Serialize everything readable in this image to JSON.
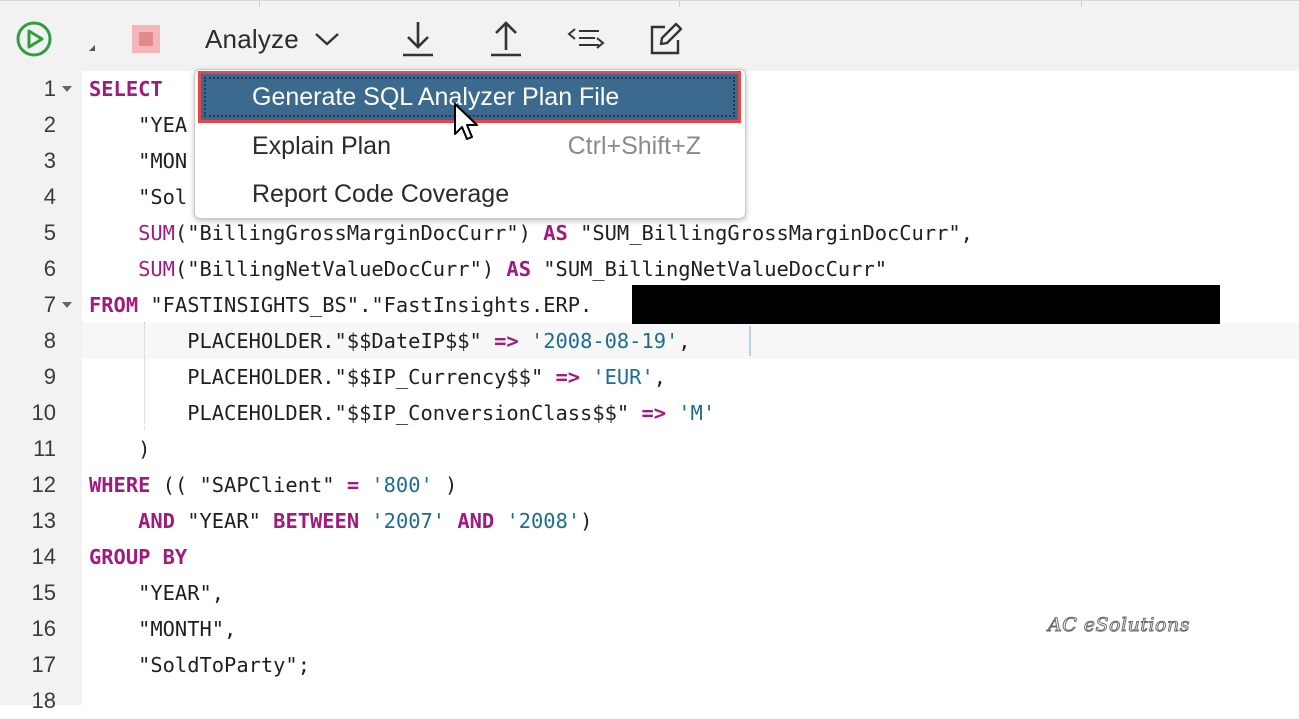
{
  "toolbar": {
    "analyze_label": "Analyze"
  },
  "menu": {
    "items": [
      {
        "label": "Generate SQL Analyzer Plan File",
        "shortcut": ""
      },
      {
        "label": "Explain Plan",
        "shortcut": "Ctrl+Shift+Z"
      },
      {
        "label": "Report Code Coverage",
        "shortcut": ""
      }
    ]
  },
  "editor": {
    "line_numbers": [
      "1",
      "2",
      "3",
      "4",
      "5",
      "6",
      "7",
      "8",
      "9",
      "10",
      "11",
      "12",
      "13",
      "14",
      "15",
      "16",
      "17",
      "18"
    ],
    "lines": [
      [
        {
          "t": "SELECT",
          "c": "kw"
        }
      ],
      [
        {
          "t": "    \"YEA",
          "c": ""
        }
      ],
      [
        {
          "t": "    \"MON",
          "c": ""
        }
      ],
      [
        {
          "t": "    \"Sol",
          "c": ""
        }
      ],
      [
        {
          "t": "    ",
          "c": ""
        },
        {
          "t": "SUM",
          "c": "fn"
        },
        {
          "t": "(\"BillingGrossMarginDocCurr\") ",
          "c": ""
        },
        {
          "t": "AS",
          "c": "kw"
        },
        {
          "t": " \"SUM_BillingGrossMarginDocCurr\",",
          "c": ""
        }
      ],
      [
        {
          "t": "    ",
          "c": ""
        },
        {
          "t": "SUM",
          "c": "fn"
        },
        {
          "t": "(\"BillingNetValueDocCurr\") ",
          "c": ""
        },
        {
          "t": "AS",
          "c": "kw"
        },
        {
          "t": " \"SUM_BillingNetValueDocCurr\"",
          "c": ""
        }
      ],
      [
        {
          "t": "FROM",
          "c": "kw"
        },
        {
          "t": " \"FASTINSIGHTS_BS\".\"FastInsights.ERP.",
          "c": ""
        }
      ],
      [
        {
          "t": "        PLACEHOLDER.\"$$DateIP$$\" ",
          "c": ""
        },
        {
          "t": "=>",
          "c": "op"
        },
        {
          "t": " ",
          "c": ""
        },
        {
          "t": "'2008-08-19'",
          "c": "str"
        },
        {
          "t": ",",
          "c": ""
        }
      ],
      [
        {
          "t": "        PLACEHOLDER.\"$$IP_Currency$$\" ",
          "c": ""
        },
        {
          "t": "=>",
          "c": "op"
        },
        {
          "t": " ",
          "c": ""
        },
        {
          "t": "'EUR'",
          "c": "str"
        },
        {
          "t": ",",
          "c": ""
        }
      ],
      [
        {
          "t": "        PLACEHOLDER.\"$$IP_ConversionClass$$\" ",
          "c": ""
        },
        {
          "t": "=>",
          "c": "op"
        },
        {
          "t": " ",
          "c": ""
        },
        {
          "t": "'M'",
          "c": "str"
        }
      ],
      [
        {
          "t": "    )",
          "c": ""
        }
      ],
      [
        {
          "t": "WHERE",
          "c": "kw"
        },
        {
          "t": " (( \"SAPClient\" ",
          "c": ""
        },
        {
          "t": "=",
          "c": "op"
        },
        {
          "t": " ",
          "c": ""
        },
        {
          "t": "'800'",
          "c": "str"
        },
        {
          "t": " )",
          "c": ""
        }
      ],
      [
        {
          "t": "    ",
          "c": ""
        },
        {
          "t": "AND",
          "c": "kw"
        },
        {
          "t": " \"YEAR\" ",
          "c": ""
        },
        {
          "t": "BETWEEN",
          "c": "kw"
        },
        {
          "t": " ",
          "c": ""
        },
        {
          "t": "'2007'",
          "c": "str"
        },
        {
          "t": " ",
          "c": ""
        },
        {
          "t": "AND",
          "c": "kw"
        },
        {
          "t": " ",
          "c": ""
        },
        {
          "t": "'2008'",
          "c": "str"
        },
        {
          "t": ")",
          "c": ""
        }
      ],
      [
        {
          "t": "GROUP BY",
          "c": "kw"
        }
      ],
      [
        {
          "t": "    \"YEAR\",",
          "c": ""
        }
      ],
      [
        {
          "t": "    \"MONTH\",",
          "c": ""
        }
      ],
      [
        {
          "t": "    \"SoldToParty\";",
          "c": ""
        }
      ],
      [
        {
          "t": "",
          "c": ""
        }
      ]
    ],
    "folded_lines": [
      1,
      7
    ],
    "active_line": 8
  },
  "watermark": "AC eSolutions"
}
